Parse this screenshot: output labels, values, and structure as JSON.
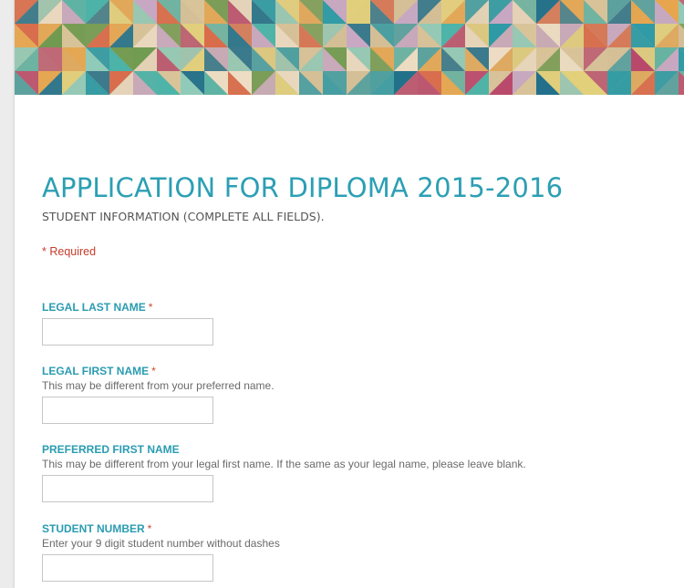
{
  "form": {
    "title": "APPLICATION FOR DIPLOMA 2015-2016",
    "description": "STUDENT INFORMATION (COMPLETE ALL FIELDS).",
    "required_note": "* Required",
    "questions": [
      {
        "label": "LEGAL LAST NAME",
        "required": "*",
        "help": "",
        "value": ""
      },
      {
        "label": "LEGAL FIRST NAME",
        "required": "*",
        "help": "This may be different from your preferred name.",
        "value": ""
      },
      {
        "label": "PREFERRED FIRST NAME",
        "required": "",
        "help": "This may be different from your legal first name. If the same as your legal name, please leave blank.",
        "value": ""
      },
      {
        "label": "STUDENT NUMBER",
        "required": "*",
        "help": "Enter your 9 digit student number without dashes",
        "value": ""
      }
    ]
  },
  "banner": {
    "palette": [
      "#1f6f8b",
      "#2a9aa6",
      "#4bb3a8",
      "#8fcbb9",
      "#d9c49a",
      "#e8a54b",
      "#d86b4a",
      "#b9466a",
      "#c7a7c4",
      "#f0e0c8",
      "#6e9a4f",
      "#e4d27a"
    ]
  }
}
